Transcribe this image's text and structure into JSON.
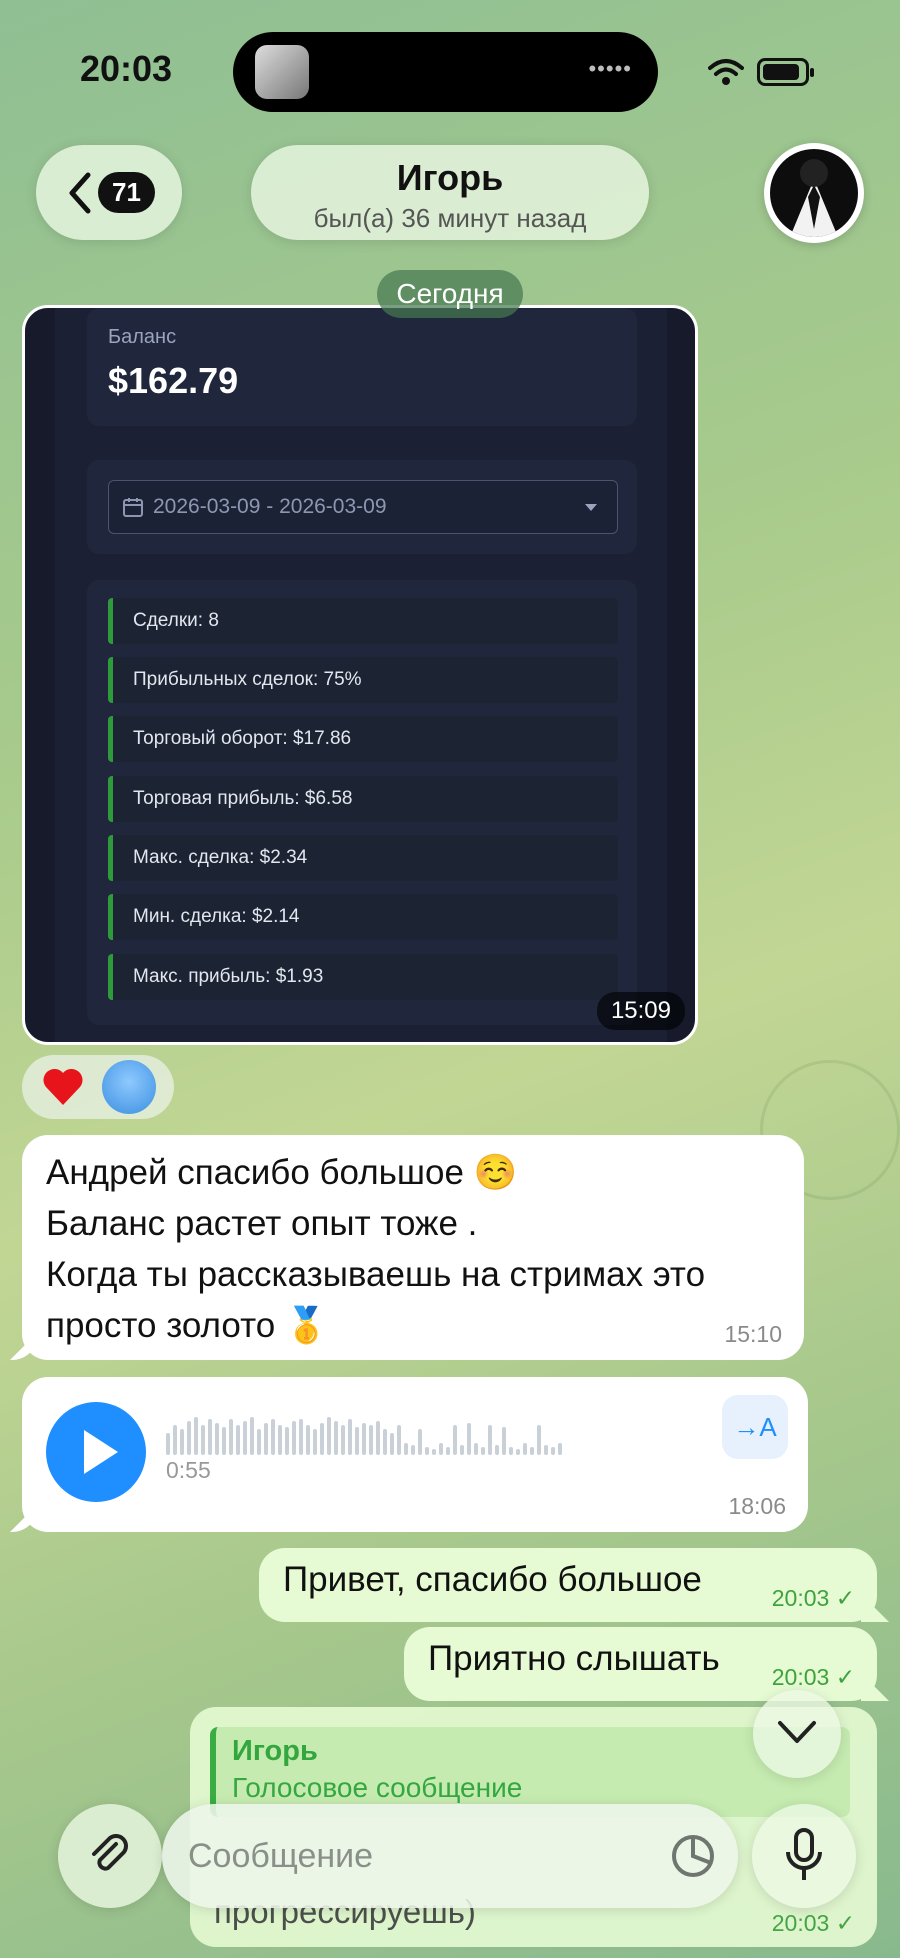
{
  "status_bar": {
    "time": "20:03"
  },
  "header": {
    "unread_count": "71",
    "title": "Игорь",
    "subtitle": "был(а) 36 минут назад"
  },
  "date_separator": "Сегодня",
  "screenshot": {
    "balance_label": "Баланс",
    "balance_value": "$162.79",
    "date_range": "2026-03-09 - 2026-03-09",
    "stats": [
      "Сделки: 8",
      "Прибыльных сделок: 75%",
      "Торговый оборот: $17.86",
      "Торговая прибыль: $6.58",
      "Макс. сделка: $2.34",
      "Мин. сделка: $2.14",
      "Макс. прибыль: $1.93"
    ],
    "time": "15:09"
  },
  "reactions": {
    "emoji": "heart-icon"
  },
  "messages": {
    "incoming_text": {
      "lines": [
        "Андрей спасибо большое ☺️",
        "Баланс растет опыт тоже .",
        "Когда ты рассказываешь на стримах это просто золото 🥇"
      ],
      "time": "15:10"
    },
    "voice": {
      "duration": "0:55",
      "transcribe_label": "→A",
      "time": "18:06"
    },
    "outgoing": [
      {
        "text": "Привет, спасибо большое",
        "time": "20:03"
      },
      {
        "text": "Приятно слышать",
        "time": "20:03"
      }
    ],
    "reply": {
      "quoted_name": "Игорь",
      "quoted_type": "Голосовое сообщение",
      "text": "прогрессируешь)",
      "time": "20:03"
    }
  },
  "composer": {
    "placeholder": "Сообщение"
  },
  "colors": {
    "accent": "#1f8fff",
    "outgoing_bubble": "#e6fbd3",
    "stat_border": "#2e9a3c"
  }
}
